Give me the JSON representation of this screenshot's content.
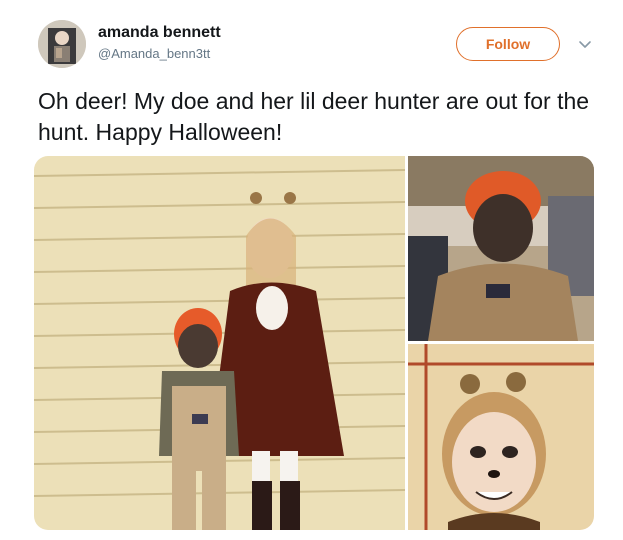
{
  "user": {
    "name": "amanda bennett",
    "handle": "@Amanda_benn3tt"
  },
  "actions": {
    "follow_label": "Follow",
    "more_icon": "chevron-down-icon"
  },
  "tweet": {
    "text": "Oh deer! My doe and her lil deer hunter are out for the hunt. Happy Halloween!"
  },
  "media": {
    "photo_count": 3
  },
  "colors": {
    "accent": "#e0702b",
    "handle": "#657786",
    "text": "#14171a"
  }
}
